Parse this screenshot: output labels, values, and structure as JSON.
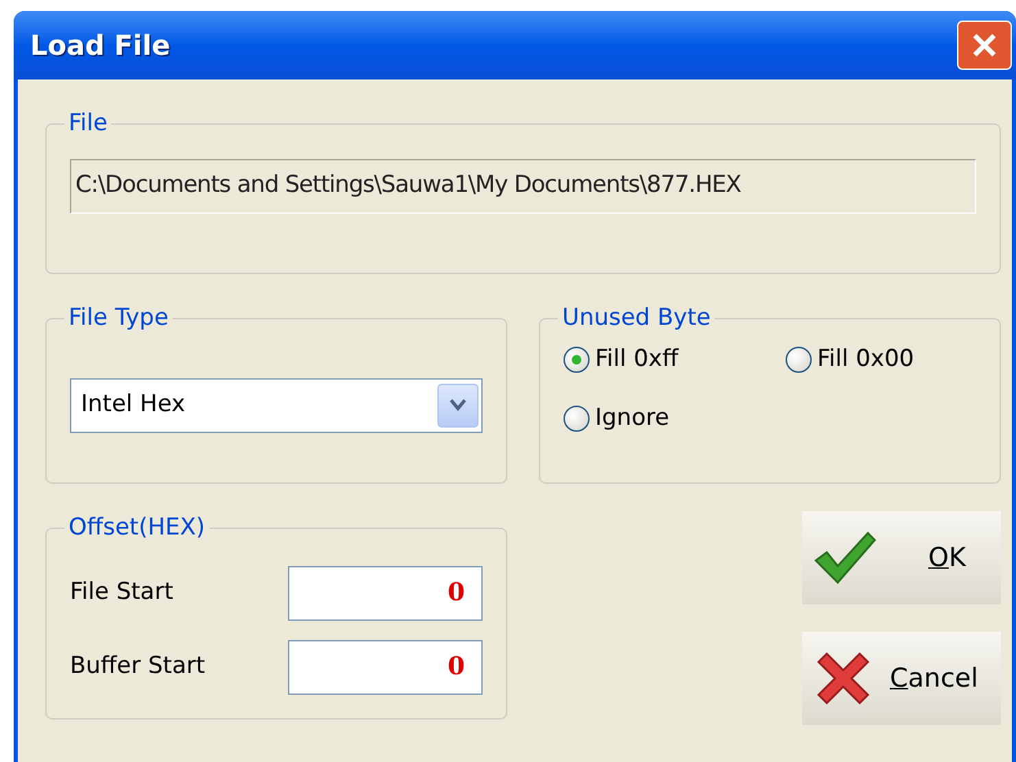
{
  "window": {
    "title": "Load File"
  },
  "file": {
    "legend": "File",
    "path": "C:\\Documents and Settings\\Sauwa1\\My Documents\\877.HEX"
  },
  "file_type": {
    "legend": "File Type",
    "value": "Intel Hex"
  },
  "unused_byte": {
    "legend": "Unused Byte",
    "options": [
      {
        "label": "Fill 0xff",
        "selected": true
      },
      {
        "label": "Fill 0x00",
        "selected": false
      },
      {
        "label": "Ignore",
        "selected": false
      }
    ]
  },
  "offset": {
    "legend": "Offset(HEX)",
    "fields": [
      {
        "label": "File Start",
        "value": "0"
      },
      {
        "label": "Buffer Start",
        "value": "0"
      }
    ]
  },
  "buttons": [
    {
      "kind": "ok",
      "label": "OK",
      "underline_first": true
    },
    {
      "kind": "cancel",
      "label": "Cancel",
      "underline_first": true
    }
  ]
}
